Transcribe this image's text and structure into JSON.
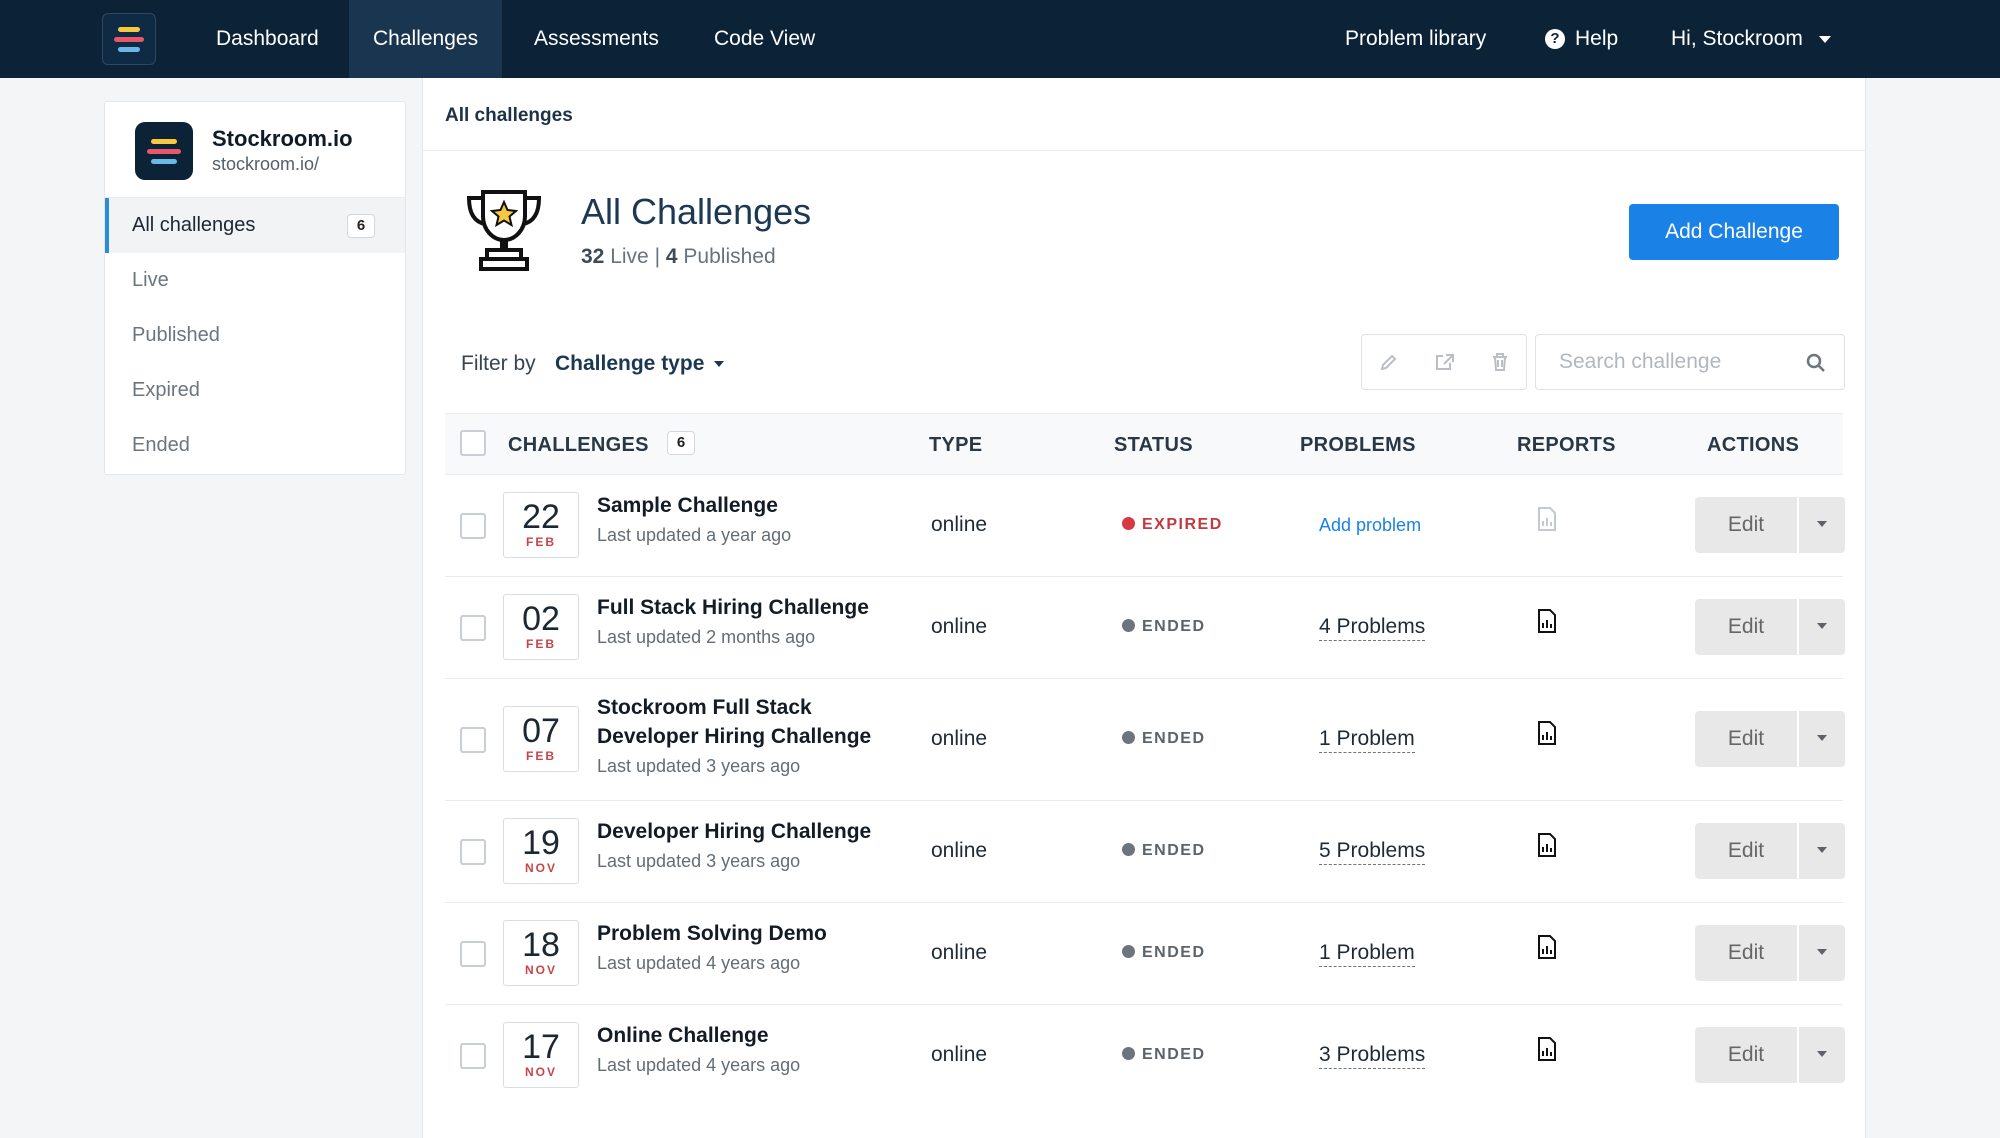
{
  "nav": {
    "items": [
      "Dashboard",
      "Challenges",
      "Assessments",
      "Code View"
    ],
    "active": "Challenges",
    "right": {
      "problem_library": "Problem library",
      "help": "Help",
      "user_greeting": "Hi, Stockroom"
    }
  },
  "sidebar": {
    "org_name": "Stockroom.io",
    "org_url": "stockroom.io/",
    "items": [
      {
        "label": "All challenges",
        "count": "6",
        "active": true
      },
      {
        "label": "Live"
      },
      {
        "label": "Published"
      },
      {
        "label": "Expired"
      },
      {
        "label": "Ended"
      }
    ]
  },
  "main": {
    "breadcrumb": "All challenges",
    "title": "All Challenges",
    "stats": {
      "live_count": "32",
      "live_label": "Live",
      "separator": "|",
      "published_count": "4",
      "published_label": "Published"
    },
    "add_button": "Add Challenge",
    "filter": {
      "label": "Filter by",
      "value": "Challenge type"
    },
    "search": {
      "placeholder": "Search challenge"
    }
  },
  "table": {
    "headers": {
      "challenges": "CHALLENGES",
      "count": "6",
      "type": "TYPE",
      "status": "STATUS",
      "problems": "PROBLEMS",
      "reports": "REPORTS",
      "actions": "ACTIONS"
    },
    "rows": [
      {
        "day": "22",
        "month": "FEB",
        "name": "Sample Challenge",
        "updated": "Last updated a year ago",
        "type": "online",
        "status": "EXPIRED",
        "problems": "Add problem",
        "action": "Edit"
      },
      {
        "day": "02",
        "month": "FEB",
        "name": "Full Stack Hiring Challenge",
        "updated": "Last updated 2 months ago",
        "type": "online",
        "status": "ENDED",
        "problems": "4 Problems",
        "action": "Edit"
      },
      {
        "day": "07",
        "month": "FEB",
        "name": "Stockroom Full Stack Developer Hiring Challenge",
        "updated": "Last updated 3 years ago",
        "type": "online",
        "status": "ENDED",
        "problems": "1 Problem",
        "action": "Edit"
      },
      {
        "day": "19",
        "month": "NOV",
        "name": "Developer Hiring Challenge",
        "updated": "Last updated 3 years ago",
        "type": "online",
        "status": "ENDED",
        "problems": "5 Problems",
        "action": "Edit"
      },
      {
        "day": "18",
        "month": "NOV",
        "name": "Problem Solving Demo",
        "updated": "Last updated 4 years ago",
        "type": "online",
        "status": "ENDED",
        "problems": "1 Problem",
        "action": "Edit"
      },
      {
        "day": "17",
        "month": "NOV",
        "name": "Online Challenge",
        "updated": "Last updated 4 years ago",
        "type": "online",
        "status": "ENDED",
        "problems": "3 Problems",
        "action": "Edit"
      }
    ]
  },
  "colors": {
    "nav_bg": "#0c2237",
    "accent": "#1a82e6",
    "expired": "#d63a40",
    "ended": "#6c757d",
    "logo_yellow": "#f5c842",
    "logo_red": "#e8566a",
    "logo_blue": "#6ab8e8"
  },
  "icons": {
    "logo": "stockroom-logo-icon",
    "help": "question-circle-icon",
    "user_menu": "caret-down-icon",
    "trophy": "trophy-icon",
    "edit": "pencil-icon",
    "share": "external-link-icon",
    "delete": "trash-icon",
    "search": "search-icon",
    "report": "report-document-icon"
  }
}
